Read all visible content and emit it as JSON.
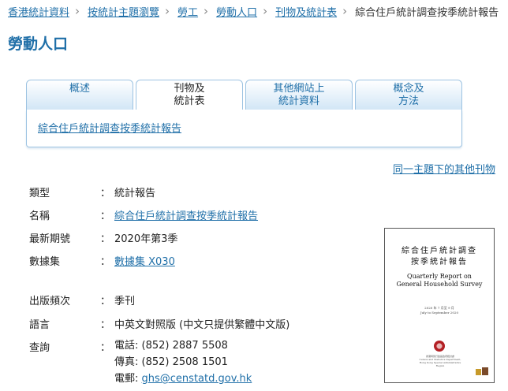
{
  "breadcrumb": [
    {
      "label": "香港統計資料",
      "link": true
    },
    {
      "label": "按統計主題瀏覽",
      "link": true
    },
    {
      "label": "勞工",
      "link": true
    },
    {
      "label": "勞動人口",
      "link": true
    },
    {
      "label": "刊物及統計表",
      "link": true
    },
    {
      "label": "綜合住戶統計調查按季統計報告",
      "link": false
    }
  ],
  "page_title": "勞動人口",
  "tabs": [
    {
      "line1": "概述",
      "line2": ""
    },
    {
      "line1": "刊物及",
      "line2": "統計表"
    },
    {
      "line1": "其他網站上",
      "line2": "統計資料"
    },
    {
      "line1": "概念及",
      "line2": "方法"
    }
  ],
  "tab_panel_link": "綜合住戶統計調查按季統計報告",
  "other_publications_link": "同一主題下的其他刊物",
  "info": {
    "type_label": "類型",
    "type_value": "統計報告",
    "name_label": "名稱",
    "name_value": "綜合住戶統計調查按季統計報告",
    "issue_label": "最新期號",
    "issue_value": "2020年第3季",
    "dataset_label": "數據集",
    "dataset_value": "數據集 X030",
    "frequency_label": "出版頻次",
    "frequency_value": "季刊",
    "language_label": "語言",
    "language_value": "中英文對照版 (中文只提供繁體中文版)",
    "enquiry_label": "查詢",
    "phone": "電話: (852) 2887 5508",
    "fax": "傳真: (852) 2508 1501",
    "email_prefix": "電郵: ",
    "email": "ghs@censtatd.gov.hk",
    "colon": "："
  },
  "cover": {
    "zh_line1": "綜合住戶統計調查",
    "zh_line2": "按季統計報告",
    "en_line1": "Quarterly Report on",
    "en_line2": "General Household Survey",
    "period_zh": "2020 年 7 月至 9 月",
    "period_en": "July to September 2020",
    "dept_zh": "香港特別行政區政府統計處",
    "dept_en": "Census and Statistics Department, Hong Kong Special Administrative Region"
  },
  "colors": {
    "link": "#1f6fa8",
    "tab_border": "#9dc3e2",
    "seal": "#b31f24"
  }
}
